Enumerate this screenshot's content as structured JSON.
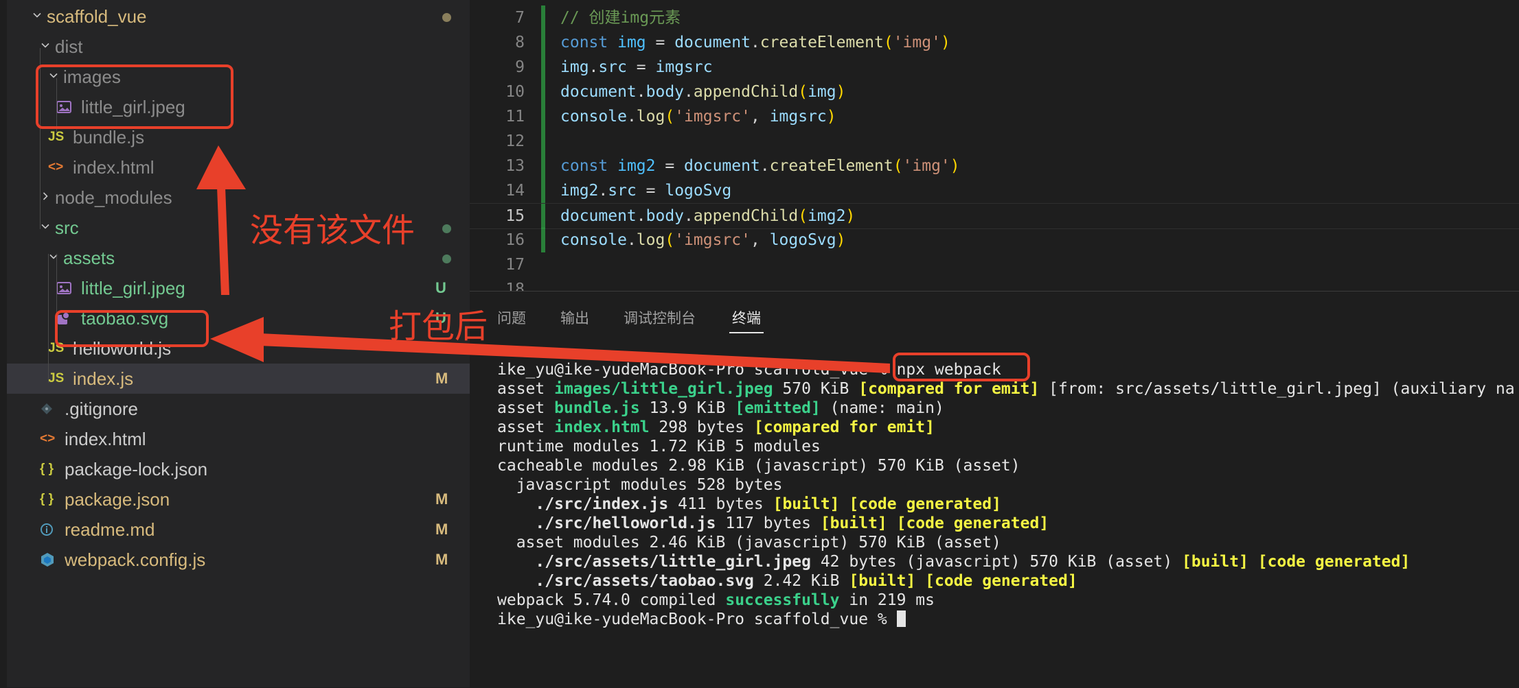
{
  "explorer": {
    "rows": [
      {
        "label": "scaffold_vue",
        "color": "c-yellow",
        "chevron": "down",
        "badge_dot": true
      },
      {
        "label": "dist",
        "color": "c-grey",
        "chevron": "down"
      },
      {
        "label": "images",
        "color": "c-grey",
        "chevron": "down"
      },
      {
        "label": "little_girl.jpeg",
        "color": "c-grey",
        "icon": "image-icon"
      },
      {
        "label": "bundle.js",
        "color": "c-grey",
        "icon": "js-icon",
        "icon_text": "JS"
      },
      {
        "label": "index.html",
        "color": "c-grey",
        "icon": "html-icon",
        "icon_text": "<>"
      },
      {
        "label": "node_modules",
        "color": "c-grey",
        "chevron": "right"
      },
      {
        "label": "src",
        "color": "c-green",
        "chevron": "down",
        "badge_dot": true
      },
      {
        "label": "assets",
        "color": "c-green",
        "chevron": "down",
        "badge_dot": true
      },
      {
        "label": "little_girl.jpeg",
        "color": "c-green",
        "icon": "image-icon",
        "badge": "U"
      },
      {
        "label": "taobao.svg",
        "color": "c-green",
        "icon": "svg-icon",
        "badge": "U"
      },
      {
        "label": "helloworld.js",
        "color": "c-white",
        "icon": "js-icon",
        "icon_text": "JS"
      },
      {
        "label": "index.js",
        "color": "c-yellow",
        "icon": "js-icon",
        "icon_text": "JS",
        "badge": "M",
        "active": true
      },
      {
        "label": ".gitignore",
        "color": "c-white",
        "icon": "gitignore-icon"
      },
      {
        "label": "index.html",
        "color": "c-white",
        "icon": "html-icon",
        "icon_text": "<>"
      },
      {
        "label": "package-lock.json",
        "color": "c-white",
        "icon": "json-icon",
        "icon_text": "{ }"
      },
      {
        "label": "package.json",
        "color": "c-yellow",
        "icon": "json-icon",
        "icon_text": "{ }",
        "badge": "M"
      },
      {
        "label": "readme.md",
        "color": "c-yellow",
        "icon": "info-icon",
        "badge": "M"
      },
      {
        "label": "webpack.config.js",
        "color": "c-yellow",
        "icon": "webpack-icon",
        "badge": "M"
      }
    ]
  },
  "editor": {
    "current_line": "15",
    "lines": [
      {
        "n": "7",
        "parts": [
          [
            "t-com",
            "// 创建img元素"
          ]
        ]
      },
      {
        "n": "8",
        "parts": [
          [
            "t-kw",
            "const "
          ],
          [
            "t-const",
            "img"
          ],
          [
            "t-pl",
            " = "
          ],
          [
            "t-var",
            "document"
          ],
          [
            "t-pl",
            "."
          ],
          [
            "t-fn",
            "createElement"
          ],
          [
            "t-p1",
            "("
          ],
          [
            "t-str",
            "'img'"
          ],
          [
            "t-p1",
            ")"
          ]
        ]
      },
      {
        "n": "9",
        "parts": [
          [
            "t-var",
            "img"
          ],
          [
            "t-pl",
            "."
          ],
          [
            "t-var",
            "src"
          ],
          [
            "t-pl",
            " = "
          ],
          [
            "t-var",
            "imgsrc"
          ]
        ]
      },
      {
        "n": "10",
        "parts": [
          [
            "t-var",
            "document"
          ],
          [
            "t-pl",
            "."
          ],
          [
            "t-var",
            "body"
          ],
          [
            "t-pl",
            "."
          ],
          [
            "t-fn",
            "appendChild"
          ],
          [
            "t-p1",
            "("
          ],
          [
            "t-var",
            "img"
          ],
          [
            "t-p1",
            ")"
          ]
        ]
      },
      {
        "n": "11",
        "parts": [
          [
            "t-var",
            "console"
          ],
          [
            "t-pl",
            "."
          ],
          [
            "t-fn",
            "log"
          ],
          [
            "t-p1",
            "("
          ],
          [
            "t-str",
            "'imgsrc'"
          ],
          [
            "t-pl",
            ", "
          ],
          [
            "t-var",
            "imgsrc"
          ],
          [
            "t-p1",
            ")"
          ]
        ]
      },
      {
        "n": "12",
        "parts": []
      },
      {
        "n": "13",
        "parts": [
          [
            "t-kw",
            "const "
          ],
          [
            "t-const",
            "img2"
          ],
          [
            "t-pl",
            " = "
          ],
          [
            "t-var",
            "document"
          ],
          [
            "t-pl",
            "."
          ],
          [
            "t-fn",
            "createElement"
          ],
          [
            "t-p1",
            "("
          ],
          [
            "t-str",
            "'img'"
          ],
          [
            "t-p1",
            ")"
          ]
        ]
      },
      {
        "n": "14",
        "parts": [
          [
            "t-var",
            "img2"
          ],
          [
            "t-pl",
            "."
          ],
          [
            "t-var",
            "src"
          ],
          [
            "t-pl",
            " = "
          ],
          [
            "t-var",
            "logoSvg"
          ]
        ]
      },
      {
        "n": "15",
        "parts": [
          [
            "t-var",
            "document"
          ],
          [
            "t-pl",
            "."
          ],
          [
            "t-var",
            "body"
          ],
          [
            "t-pl",
            "."
          ],
          [
            "t-fn",
            "appendChild"
          ],
          [
            "t-p1",
            "("
          ],
          [
            "t-var",
            "img2"
          ],
          [
            "t-p1",
            ")"
          ]
        ]
      },
      {
        "n": "16",
        "parts": [
          [
            "t-var",
            "console"
          ],
          [
            "t-pl",
            "."
          ],
          [
            "t-fn",
            "log"
          ],
          [
            "t-p1",
            "("
          ],
          [
            "t-str",
            "'imgsrc'"
          ],
          [
            "t-pl",
            ", "
          ],
          [
            "t-var",
            "logoSvg"
          ],
          [
            "t-p1",
            ")"
          ]
        ]
      },
      {
        "n": "17",
        "parts": []
      },
      {
        "n": "18",
        "parts": []
      }
    ]
  },
  "panel": {
    "tabs": [
      "问题",
      "输出",
      "调试控制台",
      "终端"
    ],
    "active_tab": "终端"
  },
  "terminal": {
    "lines": [
      [
        [
          "",
          "ike_yu@ike-yudeMacBook-Pro scaffold_vue % npx webpack"
        ]
      ],
      [
        [
          "",
          "asset "
        ],
        [
          "g b",
          "images/little_girl.jpeg"
        ],
        [
          "",
          " 570 KiB "
        ],
        [
          "y b",
          "[compared for emit]"
        ],
        [
          "",
          " [from: src/assets/little_girl.jpeg] (auxiliary na"
        ]
      ],
      [
        [
          "",
          "asset "
        ],
        [
          "g b",
          "bundle.js"
        ],
        [
          "",
          " 13.9 KiB "
        ],
        [
          "g b",
          "[emitted]"
        ],
        [
          "",
          " (name: main)"
        ]
      ],
      [
        [
          "",
          "asset "
        ],
        [
          "g b",
          "index.html"
        ],
        [
          "",
          " 298 bytes "
        ],
        [
          "y b",
          "[compared for emit]"
        ]
      ],
      [
        [
          "",
          "runtime modules 1.72 KiB 5 modules"
        ]
      ],
      [
        [
          "",
          "cacheable modules 2.98 KiB (javascript) 570 KiB (asset)"
        ]
      ],
      [
        [
          "",
          "  javascript modules 528 bytes"
        ]
      ],
      [
        [
          "",
          "    "
        ],
        [
          "b",
          "./src/index.js"
        ],
        [
          "",
          " 411 bytes "
        ],
        [
          "y b",
          "[built] [code generated]"
        ]
      ],
      [
        [
          "",
          "    "
        ],
        [
          "b",
          "./src/helloworld.js"
        ],
        [
          "",
          " 117 bytes "
        ],
        [
          "y b",
          "[built] [code generated]"
        ]
      ],
      [
        [
          "",
          "  asset modules 2.46 KiB (javascript) 570 KiB (asset)"
        ]
      ],
      [
        [
          "",
          "    "
        ],
        [
          "b",
          "./src/assets/little_girl.jpeg"
        ],
        [
          "",
          " 42 bytes (javascript) 570 KiB (asset) "
        ],
        [
          "y b",
          "[built] [code generated]"
        ]
      ],
      [
        [
          "",
          "    "
        ],
        [
          "b",
          "./src/assets/taobao.svg"
        ],
        [
          "",
          " 2.42 KiB "
        ],
        [
          "y b",
          "[built] [code generated]"
        ]
      ],
      [
        [
          "",
          "webpack 5.74.0 compiled "
        ],
        [
          "g b",
          "successfully"
        ],
        [
          "",
          " in 219 ms"
        ]
      ],
      [
        [
          "",
          "ike_yu@ike-yudeMacBook-Pro scaffold_vue % "
        ],
        [
          "cursor",
          ""
        ]
      ]
    ]
  },
  "annotations": {
    "no_file_text": "没有该文件",
    "after_bundle_text": "打包后",
    "accent": "#e8402a"
  }
}
